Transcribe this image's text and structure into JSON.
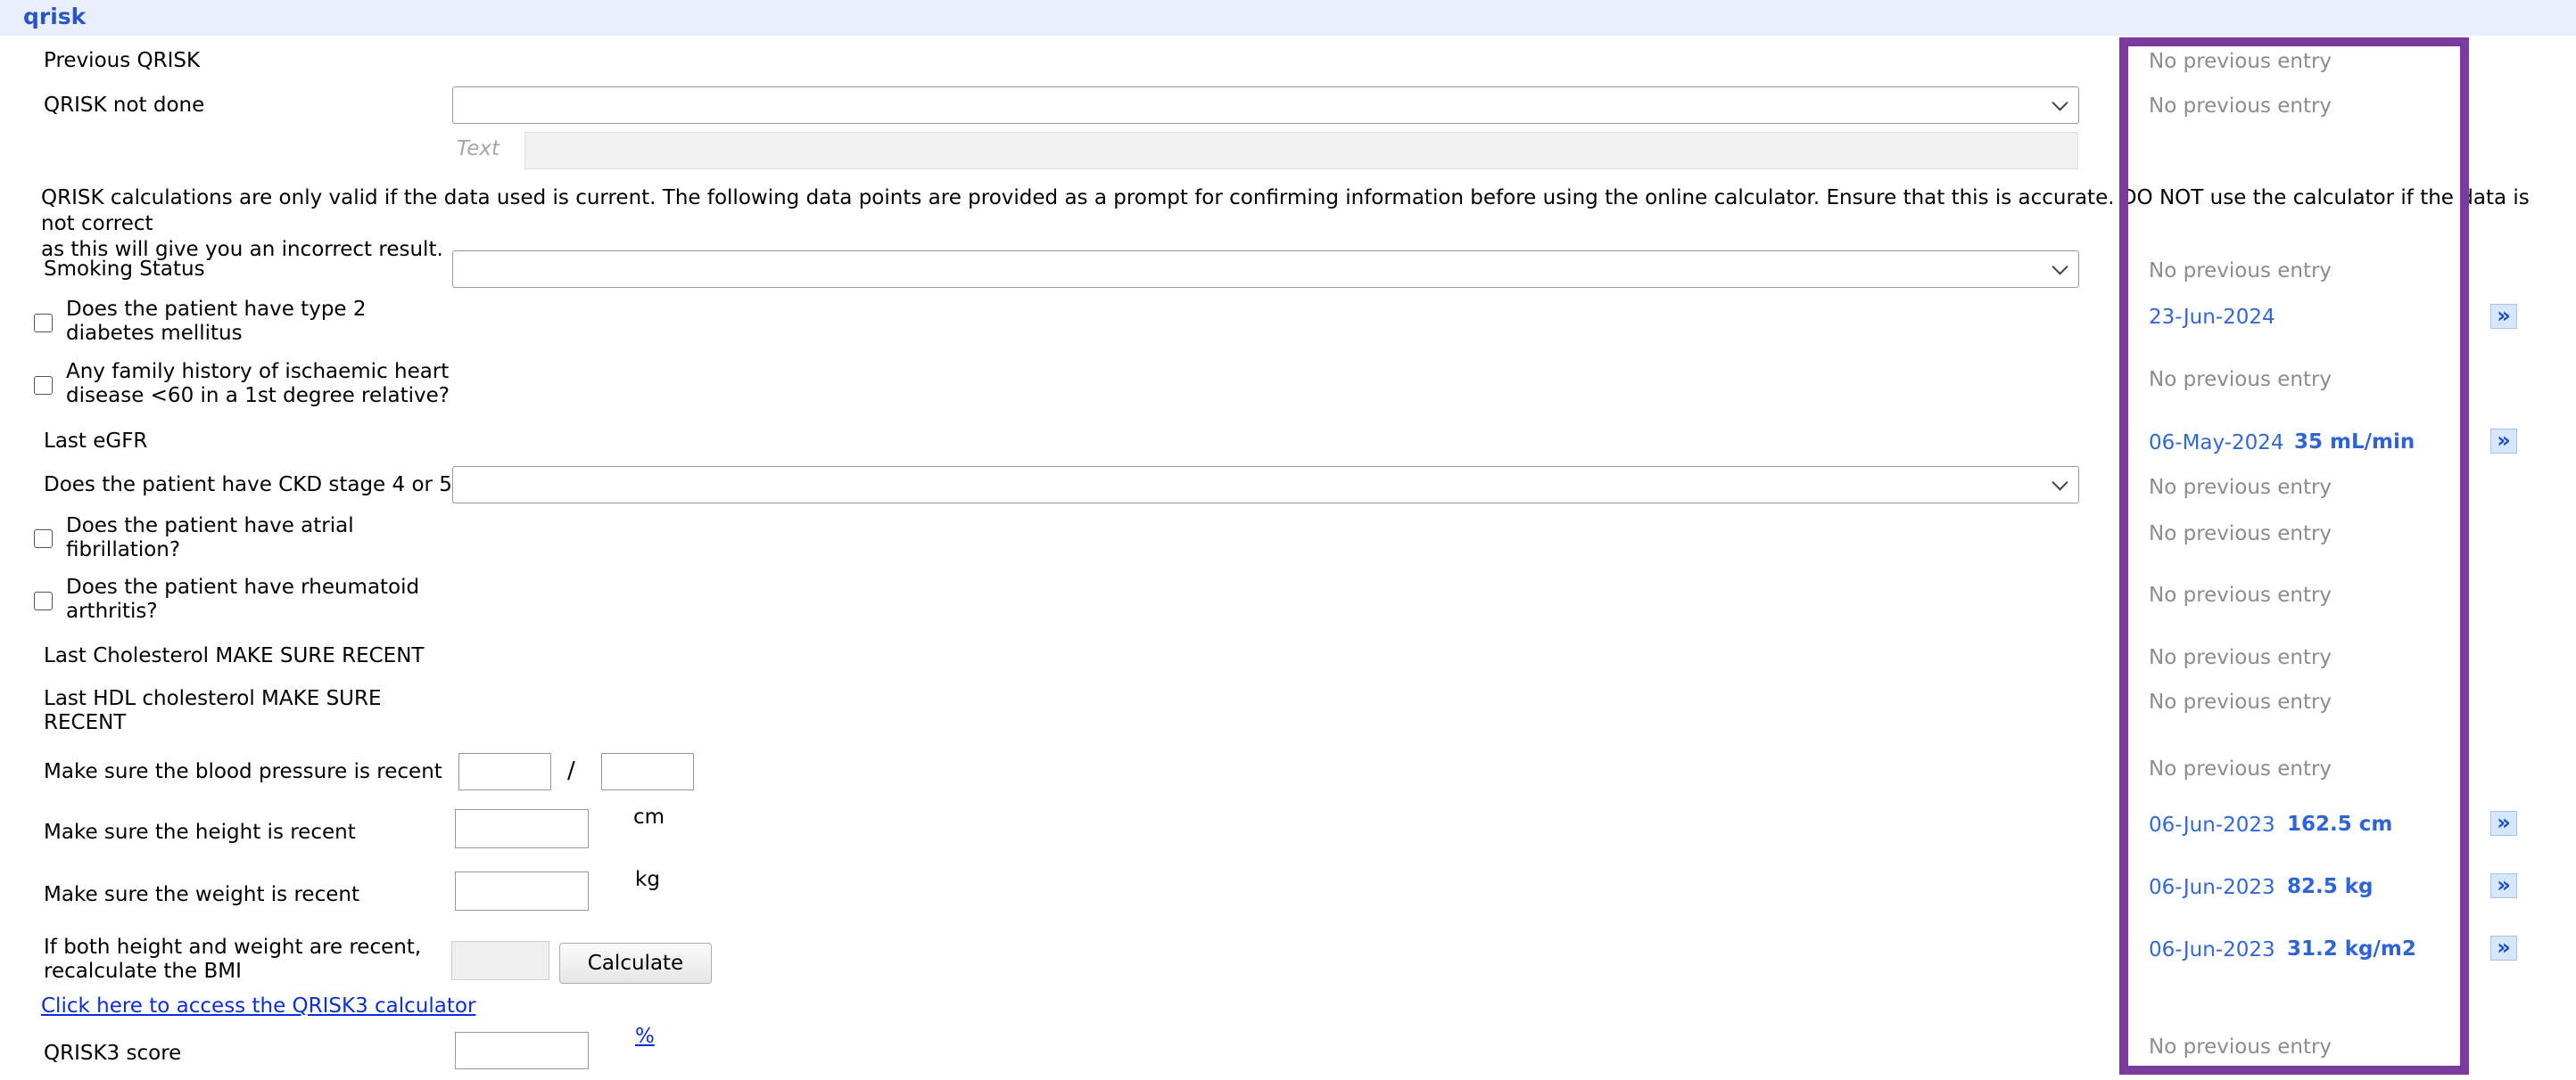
{
  "section": {
    "title": "qrisk"
  },
  "rows": {
    "previous_qrisk": {
      "label": "Previous QRISK",
      "prev": "No previous entry"
    },
    "qrisk_not_done": {
      "label": "QRISK not done",
      "prev": "No previous entry",
      "text_placeholder": "Text"
    },
    "disclaimer": {
      "line1": "QRISK calculations are only valid if the data used is current. The following data points are provided as a prompt for confirming information before using the online calculator. Ensure that this is accurate. DO NOT use the calculator if the data is not correct",
      "line2": "as this will give you an incorrect result."
    },
    "smoking_status": {
      "label": "Smoking Status",
      "prev": "No previous entry"
    },
    "type2_diabetes": {
      "label1": "Does the patient have type 2",
      "label2": "diabetes mellitus",
      "prev_date": "23-Jun-2024"
    },
    "family_history": {
      "label1": "Any family history of ischaemic heart",
      "label2": "disease <60 in a 1st degree relative?",
      "prev": "No previous entry"
    },
    "last_egfr": {
      "label": "Last eGFR",
      "prev_date": "06-May-2024",
      "prev_value": "35 mL/min"
    },
    "ckd_stage": {
      "label": "Does the patient have CKD stage 4 or 5?",
      "prev": "No previous entry"
    },
    "atrial_fibrillation": {
      "label1": "Does the patient have atrial",
      "label2": "fibrillation?",
      "prev": "No previous entry"
    },
    "rheumatoid_arthritis": {
      "label1": "Does the patient have rheumatoid",
      "label2": "arthritis?",
      "prev": "No previous entry"
    },
    "last_cholesterol": {
      "label": "Last Cholesterol MAKE SURE RECENT",
      "prev": "No previous entry"
    },
    "last_hdl": {
      "label1": "Last HDL cholesterol MAKE SURE",
      "label2": "RECENT",
      "prev": "No previous entry"
    },
    "blood_pressure": {
      "label": "Make sure the blood pressure is recent",
      "separator": "/",
      "prev": "No previous entry"
    },
    "height": {
      "label": "Make sure the height is recent",
      "unit": "cm",
      "prev_date": "06-Jun-2023",
      "prev_value": "162.5 cm"
    },
    "weight": {
      "label": "Make sure the weight is recent",
      "unit": "kg",
      "prev_date": "06-Jun-2023",
      "prev_value": "82.5 kg"
    },
    "bmi": {
      "label1": "If both height and weight are recent,",
      "label2": "recalculate the BMI",
      "button": "Calculate",
      "prev_date": "06-Jun-2023",
      "prev_value": "31.2 kg/m2"
    },
    "calculator_link": {
      "text": "Click here to access the QRISK3 calculator"
    },
    "qrisk3_score": {
      "label": "QRISK3 score",
      "unit_link": "%",
      "prev": "No previous entry"
    }
  },
  "icons": {
    "copy_forward": "double-chevron-right-icon",
    "dropdown": "chevron-down-icon"
  },
  "colors": {
    "header_bg": "#eaf0fb",
    "header_text": "#2a56c6",
    "highlight": "#7a3aa0",
    "link": "#0b2fd6"
  }
}
